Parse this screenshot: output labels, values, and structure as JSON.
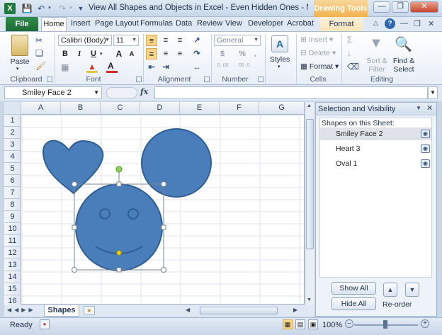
{
  "window": {
    "title": "View All Shapes and Objects in Excel - Even Hidden Ones - Micro...",
    "contextual_tab_group": "Drawing Tools",
    "app_icon": "X"
  },
  "tabs": [
    "File",
    "Home",
    "Insert",
    "Page Layout",
    "Formulas",
    "Data",
    "Review",
    "View",
    "Developer",
    "Acrobat",
    "Format"
  ],
  "ribbon": {
    "clipboard": {
      "label": "Clipboard",
      "paste": "Paste"
    },
    "font": {
      "label": "Font",
      "font_name": "Calibri (Body)",
      "font_size": "11",
      "bold": "B",
      "italic": "I",
      "underline": "U",
      "grow": "A",
      "shrink": "A"
    },
    "alignment": {
      "label": "Alignment"
    },
    "number": {
      "label": "Number",
      "format": "General",
      "currency": "$",
      "percent": "%",
      "comma": ",",
      "inc_dec": ".0 .00",
      "dec_dec": ".00 .0"
    },
    "styles": {
      "label": "Styles"
    },
    "cells": {
      "label": "Cells",
      "insert": "Insert",
      "delete": "Delete",
      "format": "Format"
    },
    "editing": {
      "label": "Editing",
      "sort_filter_1": "Sort &",
      "sort_filter_2": "Filter",
      "find_select_1": "Find &",
      "find_select_2": "Select"
    }
  },
  "formula_bar": {
    "name_box": "Smiley Face 2",
    "fx": "fx",
    "value": ""
  },
  "sheet": {
    "columns": [
      "A",
      "B",
      "C",
      "D",
      "E",
      "F",
      "G"
    ],
    "rows": [
      "1",
      "2",
      "3",
      "4",
      "5",
      "6",
      "7",
      "8",
      "9",
      "10",
      "11",
      "12",
      "13",
      "14",
      "15",
      "16"
    ],
    "tabs": [
      "Shapes"
    ],
    "shape_color": "#4a7ebb",
    "shape_outline": "#2f5e94"
  },
  "selection_pane": {
    "title": "Selection and Visibility",
    "subtitle": "Shapes on this Sheet:",
    "shapes": [
      {
        "name": "Smiley Face 2",
        "selected": true
      },
      {
        "name": "Heart 3",
        "selected": false
      },
      {
        "name": "Oval 1",
        "selected": false
      }
    ],
    "show_all": "Show All",
    "hide_all": "Hide All",
    "reorder": "Re-order"
  },
  "status": {
    "ready": "Ready",
    "zoom": "100%"
  }
}
